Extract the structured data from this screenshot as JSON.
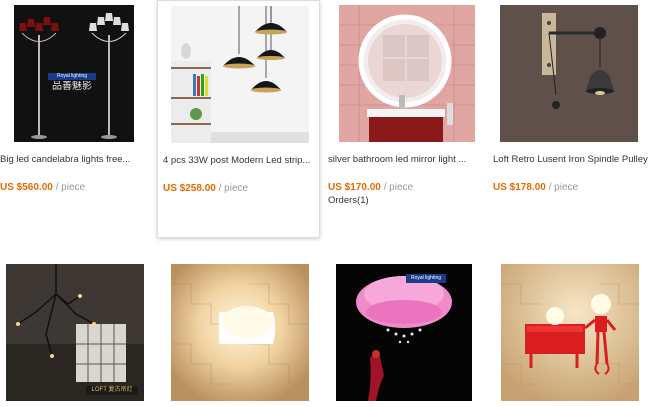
{
  "products": [
    {
      "title": "Big led candelabra lights free...",
      "price": "US $560.00",
      "unit": " / piece",
      "image_overlay_text": "品善魅影",
      "image_tag": "Royal lighting"
    },
    {
      "title": "4 pcs 33W post Modern Led strip...",
      "price": "US $258.00",
      "unit": " / piece"
    },
    {
      "title": "silver bathroom led mirror light ...",
      "price": "US $170.00",
      "unit": " / piece",
      "orders": "Orders(1)"
    },
    {
      "title": "Loft Retro Lusent Iron Spindle Pulley...",
      "price": "US $178.00",
      "unit": " / piece"
    },
    {
      "image_caption": "LOFT 复古吊灯"
    },
    {},
    {
      "image_tag": "Royal lighting"
    },
    {}
  ],
  "colors": {
    "price": "#e56a00",
    "unit": "#999999",
    "text": "#333333"
  }
}
